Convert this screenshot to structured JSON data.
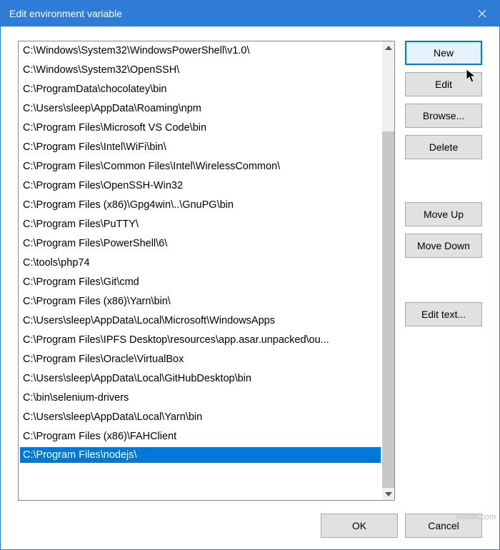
{
  "window": {
    "title": "Edit environment variable"
  },
  "list": {
    "items": [
      "C:\\Windows\\System32\\WindowsPowerShell\\v1.0\\",
      "C:\\Windows\\System32\\OpenSSH\\",
      "C:\\ProgramData\\chocolatey\\bin",
      "C:\\Users\\sleep\\AppData\\Roaming\\npm",
      "C:\\Program Files\\Microsoft VS Code\\bin",
      "C:\\Program Files\\Intel\\WiFi\\bin\\",
      "C:\\Program Files\\Common Files\\Intel\\WirelessCommon\\",
      "C:\\Program Files\\OpenSSH-Win32",
      "C:\\Program Files (x86)\\Gpg4win\\..\\GnuPG\\bin",
      "C:\\Program Files\\PuTTY\\",
      "C:\\Program Files\\PowerShell\\6\\",
      "C:\\tools\\php74",
      "C:\\Program Files\\Git\\cmd",
      "C:\\Program Files (x86)\\Yarn\\bin\\",
      "C:\\Users\\sleep\\AppData\\Local\\Microsoft\\WindowsApps",
      "C:\\Program Files\\IPFS Desktop\\resources\\app.asar.unpacked\\ou...",
      "C:\\Program Files\\Oracle\\VirtualBox",
      "C:\\Users\\sleep\\AppData\\Local\\GitHubDesktop\\bin",
      "C:\\bin\\selenium-drivers",
      "C:\\Users\\sleep\\AppData\\Local\\Yarn\\bin",
      "C:\\Program Files (x86)\\FAHClient"
    ],
    "editing_value": "C:\\Program Files\\nodejs\\"
  },
  "buttons": {
    "new": "New",
    "edit": "Edit",
    "browse": "Browse...",
    "delete": "Delete",
    "move_up": "Move Up",
    "move_down": "Move Down",
    "edit_text": "Edit text...",
    "ok": "OK",
    "cancel": "Cancel"
  },
  "watermark": "wsxdn.com"
}
